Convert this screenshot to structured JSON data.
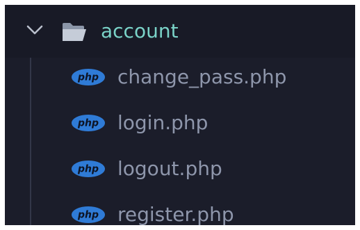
{
  "explorer": {
    "folder": {
      "name": "account",
      "expanded": true,
      "icon": "folder-open-icon",
      "chevron_icon": "chevron-down-icon",
      "label_color": "#7ad3c8"
    },
    "files": [
      {
        "name": "change_pass.php",
        "icon": "php-icon",
        "icon_text": "php"
      },
      {
        "name": "login.php",
        "icon": "php-icon",
        "icon_text": "php"
      },
      {
        "name": "logout.php",
        "icon": "php-icon",
        "icon_text": "php"
      },
      {
        "name": "register.php",
        "icon": "php-icon",
        "icon_text": "php"
      }
    ]
  },
  "colors": {
    "background": "#1b1d2a",
    "folder_row": "#181a26",
    "file_text": "#8e96ab",
    "php_badge": "#2f7bd6"
  }
}
